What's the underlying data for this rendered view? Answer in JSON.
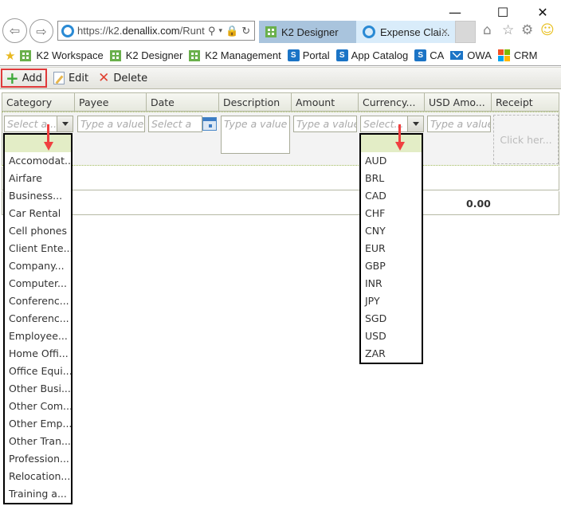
{
  "browser": {
    "url_host": "https://k2.",
    "url_domain": "denallix.com",
    "url_rest": "/Runt",
    "tabs": [
      {
        "label": "K2 Designer",
        "icon": "k2-icon",
        "active": false
      },
      {
        "label": "Expense Clai...",
        "icon": "ie-icon",
        "active": true
      }
    ],
    "favorites": [
      {
        "label": "K2 Workspace",
        "icon": "k2-icon"
      },
      {
        "label": "K2 Designer",
        "icon": "k2-icon"
      },
      {
        "label": "K2 Management",
        "icon": "k2-icon"
      },
      {
        "label": "Portal",
        "icon": "sharepoint-icon"
      },
      {
        "label": "App Catalog",
        "icon": "sharepoint-icon"
      },
      {
        "label": "CA",
        "icon": "sharepoint-icon"
      },
      {
        "label": "OWA",
        "icon": "mail-icon"
      },
      {
        "label": "CRM",
        "icon": "microsoft-icon"
      }
    ]
  },
  "toolbar": {
    "add_label": "Add",
    "edit_label": "Edit",
    "delete_label": "Delete"
  },
  "grid": {
    "columns": [
      "Category",
      "Payee",
      "Date",
      "Description",
      "Amount",
      "Currency...",
      "USD Amo...",
      "Receipt"
    ],
    "edit_row": {
      "category_placeholder": "Select a...",
      "payee_placeholder": "Type a value",
      "date_placeholder": "Select a",
      "description_placeholder": "Type a value",
      "amount_placeholder": "Type a value",
      "currency_placeholder": "Select...",
      "usd_amount_placeholder": "Type a value",
      "receipt_placeholder": "Click her..."
    },
    "row2_fragment": ")",
    "total_usd": "0.00"
  },
  "category_dropdown": {
    "options": [
      "Accomodat...",
      "Airfare",
      "Business...",
      "Car Rental",
      "Cell phones",
      "Client Ente...",
      "Company...",
      "Computer...",
      "Conferenc...",
      "Conferenc...",
      "Employee...",
      "Home Offi...",
      "Office Equi...",
      "Other Busi...",
      "Other Com...",
      "Other Emp...",
      "Other Tran...",
      "Profession...",
      "Relocation...",
      "Training a..."
    ]
  },
  "currency_dropdown": {
    "options": [
      "AUD",
      "BRL",
      "CAD",
      "CHF",
      "CNY",
      "EUR",
      "GBP",
      "INR",
      "JPY",
      "SGD",
      "USD",
      "ZAR"
    ]
  }
}
